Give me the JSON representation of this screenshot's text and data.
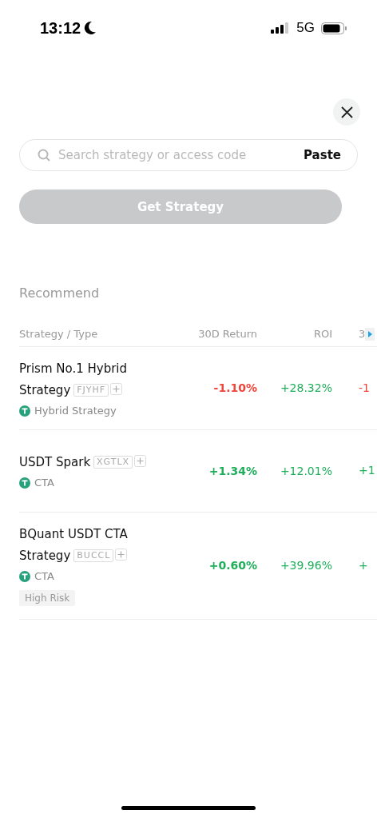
{
  "status_bar": {
    "time": "13:12",
    "network": "5G"
  },
  "search": {
    "placeholder": "Search strategy or access code",
    "paste": "Paste"
  },
  "get_button": {
    "label": "Get Strategy",
    "disabled": true
  },
  "section_title": "Recommend",
  "table": {
    "columns": [
      "Strategy / Type",
      "30D Return",
      "ROI",
      "3"
    ],
    "rows": [
      {
        "name": "Prism No.1 Hybrid Strategy",
        "code": "FJYHF",
        "type": "Hybrid Strategy",
        "return_30d": {
          "text": "-1.10%",
          "color": "#f0443a"
        },
        "roi": {
          "text": "+28.32%",
          "color": "#1fae5b"
        },
        "column_4": {
          "text": "-1",
          "color": "#f0443a"
        }
      },
      {
        "name": "USDT Spark",
        "code": "XGTLX",
        "type": "CTA",
        "return_30d": {
          "text": "+1.34%",
          "color": "#1fae5b"
        },
        "roi": {
          "text": "+12.01%",
          "color": "#1fae5b"
        },
        "column_4": {
          "text": "+1",
          "color": "#1fae5b"
        }
      },
      {
        "name": "BQuant USDT CTA Strategy",
        "code": "BUCCL",
        "type": "CTA",
        "risk": "High Risk",
        "return_30d": {
          "text": "+0.60%",
          "color": "#1fae5b"
        },
        "roi": {
          "text": "+39.96%",
          "color": "#1fae5b"
        },
        "column_4": {
          "text": "+",
          "color": "#1fae5b"
        }
      }
    ]
  }
}
